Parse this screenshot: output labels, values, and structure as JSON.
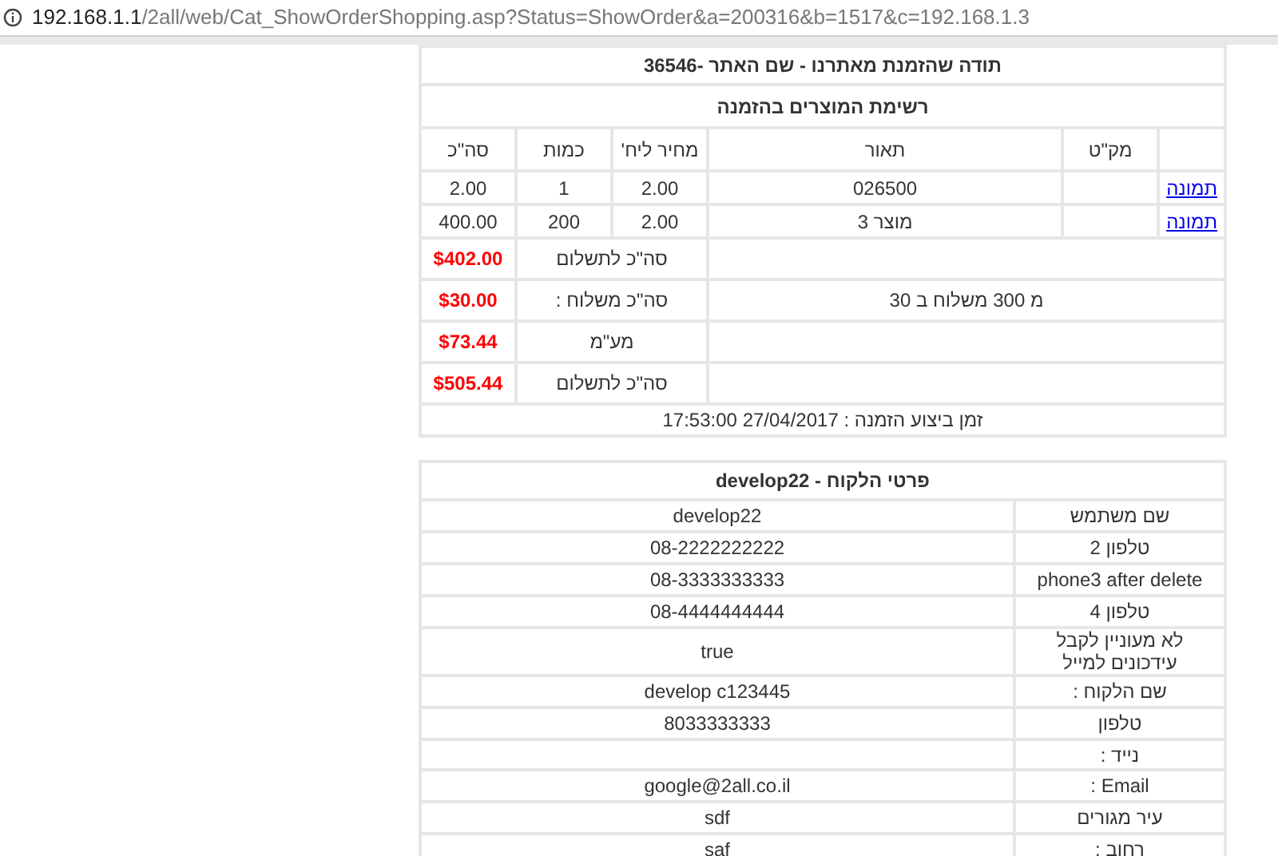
{
  "address_bar": {
    "host": "192.168.1.1",
    "path": "/2all/web/Cat_ShowOrderShopping.asp?Status=ShowOrder&a=200316&b=1517&c=192.168.1.3"
  },
  "order": {
    "title": "תודה שהזמנת מאתרנו - שם האתר -36546",
    "section_title": "רשימת המוצרים בהזמנה",
    "columns": [
      "מק\"ט",
      "תאור",
      "מחיר ליח'",
      "כמות",
      "סה\"כ"
    ],
    "rows": [
      {
        "link": "תמונה",
        "description": "026500",
        "unit_price": "2.00",
        "quantity": "1",
        "total": "2.00"
      },
      {
        "link": "תמונה",
        "description": "מוצר 3",
        "unit_price": "2.00",
        "quantity": "200",
        "total": "400.00"
      }
    ],
    "totals": [
      {
        "label": "סה\"כ לתשלום",
        "value": "$402.00"
      },
      {
        "note": "מ 300 משלוח ב 30",
        "label": "סה\"כ משלוח :",
        "value": "$30.00"
      },
      {
        "label": "מע\"מ",
        "value": "$73.44"
      },
      {
        "label": "סה\"כ לתשלום",
        "value": "$505.44"
      }
    ],
    "order_time": "זמן ביצוע הזמנה : 27/04/2017 17:53:00"
  },
  "customer": {
    "title": "פרטי הלקוח - develop22",
    "fields": [
      {
        "label": "שם משתמש",
        "value": "develop22"
      },
      {
        "label": "טלפון 2",
        "value": "08-2222222222"
      },
      {
        "label": "phone3 after delete",
        "value": "08-3333333333"
      },
      {
        "label": "טלפון 4",
        "value": "08-4444444444"
      },
      {
        "label": "לא מעוניין לקבל עידכונים למייל",
        "value": "true"
      },
      {
        "label": "שם הלקוח :",
        "value": "develop c123445"
      },
      {
        "label": "טלפון",
        "value": "8033333333"
      },
      {
        "label": "נייד :"
      },
      {
        "label": "Email :",
        "value": "google@2all.co.il"
      },
      {
        "label": "עיר מגורים",
        "value": "sdf"
      },
      {
        "label": "רחוב :",
        "value": "saf"
      }
    ]
  }
}
